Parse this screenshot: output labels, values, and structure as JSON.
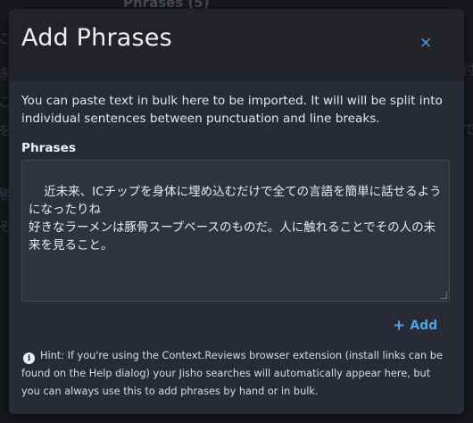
{
  "background": {
    "title": "Phrases (5)",
    "fragments": [
      "こ",
      "永",
      "こ",
      "を",
      "勝",
      "そ",
      "付",
      "で"
    ]
  },
  "dialog": {
    "title": "Add Phrases",
    "close_icon": "×",
    "description": "You can paste text in bulk here to be imported. It will will be split into individual sentences between punctuation and line breaks.",
    "phrases_label": "Phrases",
    "phrases_value": "近未来、ICチップを身体に埋め込むだけで全ての言語を簡単に話せるようになったりね\n好きなラーメンは豚骨スープベースのものだ。人に触れることでその人の未来を見ること。",
    "add_icon": "+",
    "add_label": "Add",
    "hint_icon": "i",
    "hint_text": "Hint: If you're using the Context.Reviews browser extension (install links can be found on the Help dialog) your Jisho searches will automatically appear here, but you can always use this to add phrases by hand or in bulk."
  },
  "colors": {
    "accent": "#4ea3e6",
    "dialog_bg": "#282a35",
    "header_bg": "#212329",
    "textarea_bg": "#30323e"
  }
}
